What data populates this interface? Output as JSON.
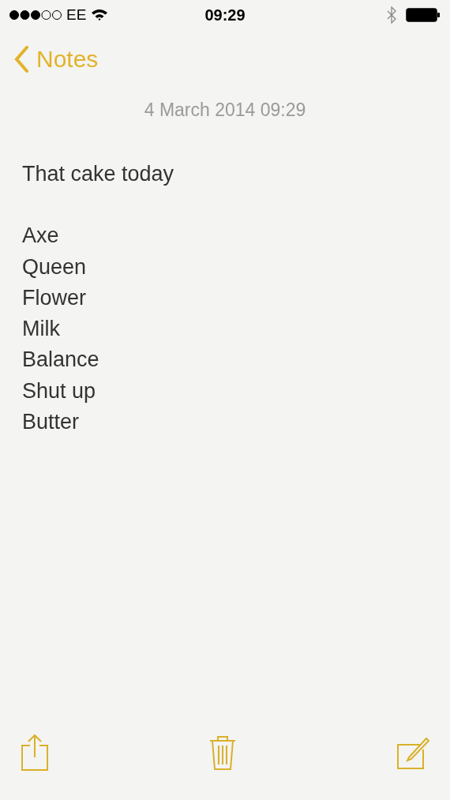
{
  "status_bar": {
    "carrier": "EE",
    "time": "09:29"
  },
  "nav": {
    "back_label": "Notes"
  },
  "note": {
    "date": "4 March 2014 09:29",
    "paragraphs": [
      {
        "lines": [
          "That cake today"
        ]
      },
      {
        "lines": [
          "Axe",
          "Queen",
          "Flower",
          "Milk",
          "Balance",
          "Shut up",
          "Butter"
        ]
      }
    ]
  }
}
